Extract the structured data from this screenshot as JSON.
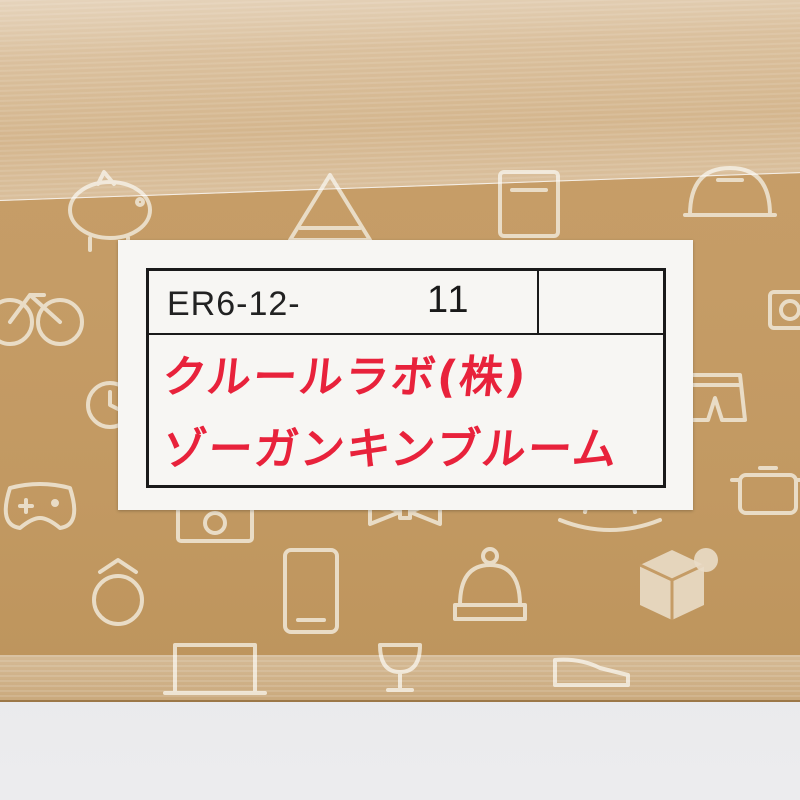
{
  "label": {
    "code_prefix": "ER6-12-",
    "code_number": "11",
    "line1": "クルールラボ(株)",
    "line2": "ゾーガンキンブルーム"
  },
  "colors": {
    "cardboard": "#c59c66",
    "icon_outline": "#e9dcc6",
    "label_paper": "#f7f6f3",
    "marker_red": "#e8223b",
    "ink_black": "#1a1a1a"
  },
  "icons": [
    "piggy-bank-icon",
    "tent-icon",
    "book-icon",
    "cap-icon",
    "bicycle-icon",
    "camera-icon",
    "clock-icon",
    "shorts-icon",
    "gamepad-icon",
    "bow-tie-icon",
    "rocking-horse-icon",
    "cooking-pot-icon",
    "ring-icon",
    "smartphone-icon",
    "knit-hat-icon",
    "box-icon",
    "laptop-icon",
    "wine-glass-icon",
    "sneaker-icon"
  ]
}
